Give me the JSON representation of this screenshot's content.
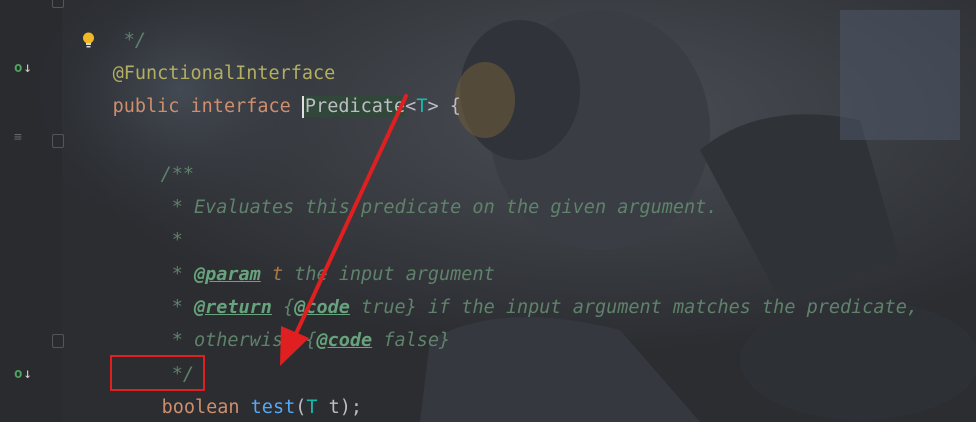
{
  "code": {
    "line_comment_end": " */",
    "line_annotation": {
      "at": "@",
      "name": "FunctionalInterface"
    },
    "line_interface": {
      "kw_public": "public",
      "kw_interface": "interface",
      "class_name": "Predicate",
      "lt": "<",
      "type_param": "T",
      "gt": ">",
      "brace": " {"
    },
    "javadoc": {
      "open": "/**",
      "line1": " * Evaluates this predicate on the given argument.",
      "line2": " *",
      "param_star": " * ",
      "param_tag": "@param",
      "param_name": " t",
      "param_desc": " the input argument",
      "return_star": " * ",
      "return_tag": "@return",
      "return_code_open": " {",
      "return_code_tag": "@code",
      "return_code_val": " true}",
      "return_desc": " if the input argument matches the predicate,",
      "otherwise_prefix": " * otherwise {",
      "otherwise_code_tag": "@code",
      "otherwise_code_val": " false}",
      "close": " */"
    },
    "method": {
      "return_type": "boolean",
      "name": "test",
      "open": "(",
      "param_type": "T",
      "param_name": " t",
      "close": ");"
    }
  },
  "colors": {
    "keyword": "#cf8e6d",
    "annotation": "#b3ae60",
    "type_param": "#16baac",
    "method_name": "#56a8f5",
    "doc_comment": "#5f826b",
    "annotation_box": "#e02020"
  },
  "icons": [
    "run-gutter-icon",
    "fold-icon",
    "doc-render-icon",
    "intention-bulb-icon"
  ]
}
